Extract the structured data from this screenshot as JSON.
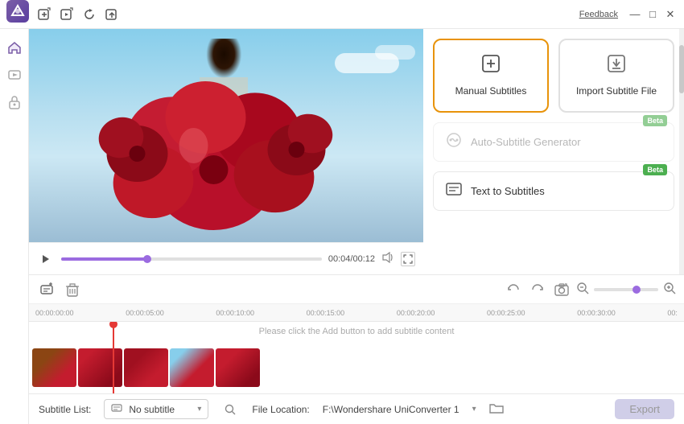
{
  "titlebar": {
    "feedback_label": "Feedback",
    "minimize_label": "—",
    "maximize_label": "□",
    "close_label": "✕"
  },
  "sidebar": {
    "logo_text": "W",
    "items": [
      {
        "name": "home",
        "icon": "⌂"
      },
      {
        "name": "video",
        "icon": "▷"
      },
      {
        "name": "lock",
        "icon": "🔒"
      }
    ]
  },
  "subtitle_options": {
    "manual": {
      "label": "Manual Subtitles",
      "icon": "+"
    },
    "import": {
      "label": "Import Subtitle File",
      "icon": "↓"
    }
  },
  "auto_subtitle": {
    "label": "Auto-Subtitle Generator",
    "badge": "Beta"
  },
  "text_to_subtitle": {
    "label": "Text to Subtitles",
    "badge": "Beta"
  },
  "playback": {
    "time_current": "00:04",
    "time_total": "00:12",
    "time_display": "00:04/00:12"
  },
  "timeline": {
    "add_message": "Please click the Add button to add subtitle content",
    "marks": [
      "00:00:00:00",
      "00:00:05:00",
      "00:00:10:00",
      "00:00:15:00",
      "00:00:20:00",
      "00:00:25:00",
      "00:00:30:00",
      "00:"
    ]
  },
  "bottom_bar": {
    "subtitle_list_label": "Subtitle List:",
    "subtitle_option": "No subtitle",
    "file_location_label": "File Location:",
    "file_path": "F:\\Wondershare UniConverter 1",
    "export_label": "Export"
  }
}
